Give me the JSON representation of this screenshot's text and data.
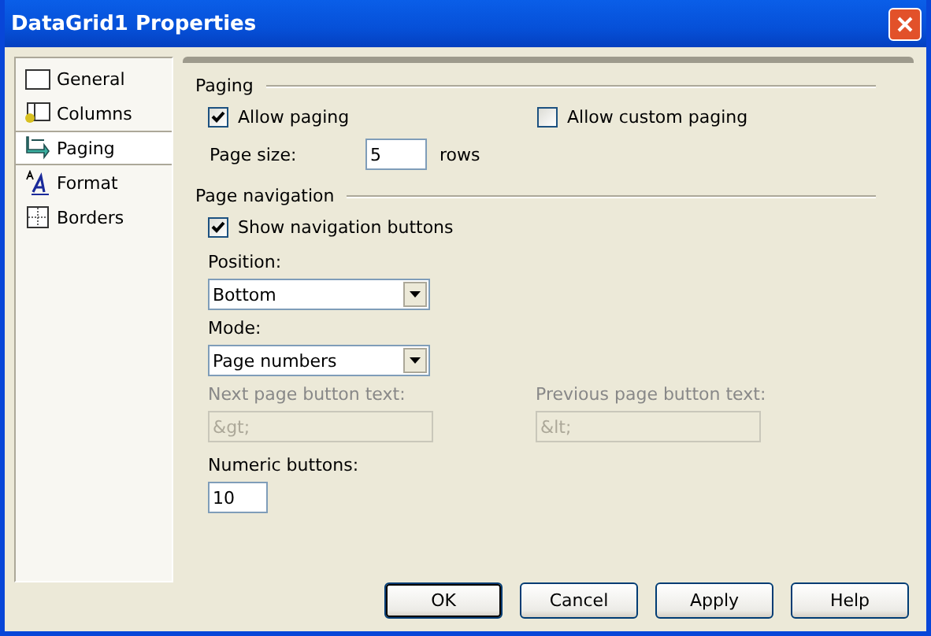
{
  "window": {
    "title": "DataGrid1 Properties"
  },
  "sidebar": {
    "items": [
      {
        "label": "General",
        "kind": "general",
        "selected": false
      },
      {
        "label": "Columns",
        "kind": "columns",
        "selected": false
      },
      {
        "label": "Paging",
        "kind": "paging",
        "selected": true
      },
      {
        "label": "Format",
        "kind": "format",
        "selected": false
      },
      {
        "label": "Borders",
        "kind": "borders",
        "selected": false
      }
    ]
  },
  "paging": {
    "heading": "Paging",
    "allow_paging": {
      "label": "Allow paging",
      "checked": true
    },
    "allow_custom_paging": {
      "label": "Allow custom paging",
      "checked": false
    },
    "page_size": {
      "label": "Page size:",
      "value": "5",
      "unit": "rows"
    }
  },
  "navigation": {
    "heading": "Page navigation",
    "show_buttons": {
      "label": "Show navigation buttons",
      "checked": true
    },
    "position": {
      "label": "Position:",
      "value": "Bottom"
    },
    "mode": {
      "label": "Mode:",
      "value": "Page numbers"
    },
    "next_text": {
      "label": "Next page button text:",
      "value": "&gt;",
      "disabled": true
    },
    "previous_text": {
      "label": "Previous page button text:",
      "value": "&lt;",
      "disabled": true
    },
    "numeric_buttons": {
      "label": "Numeric buttons:",
      "value": "10"
    }
  },
  "buttons": [
    {
      "label": "OK",
      "default": true
    },
    {
      "label": "Cancel",
      "default": false
    },
    {
      "label": "Apply",
      "default": false
    },
    {
      "label": "Help",
      "default": false
    }
  ]
}
